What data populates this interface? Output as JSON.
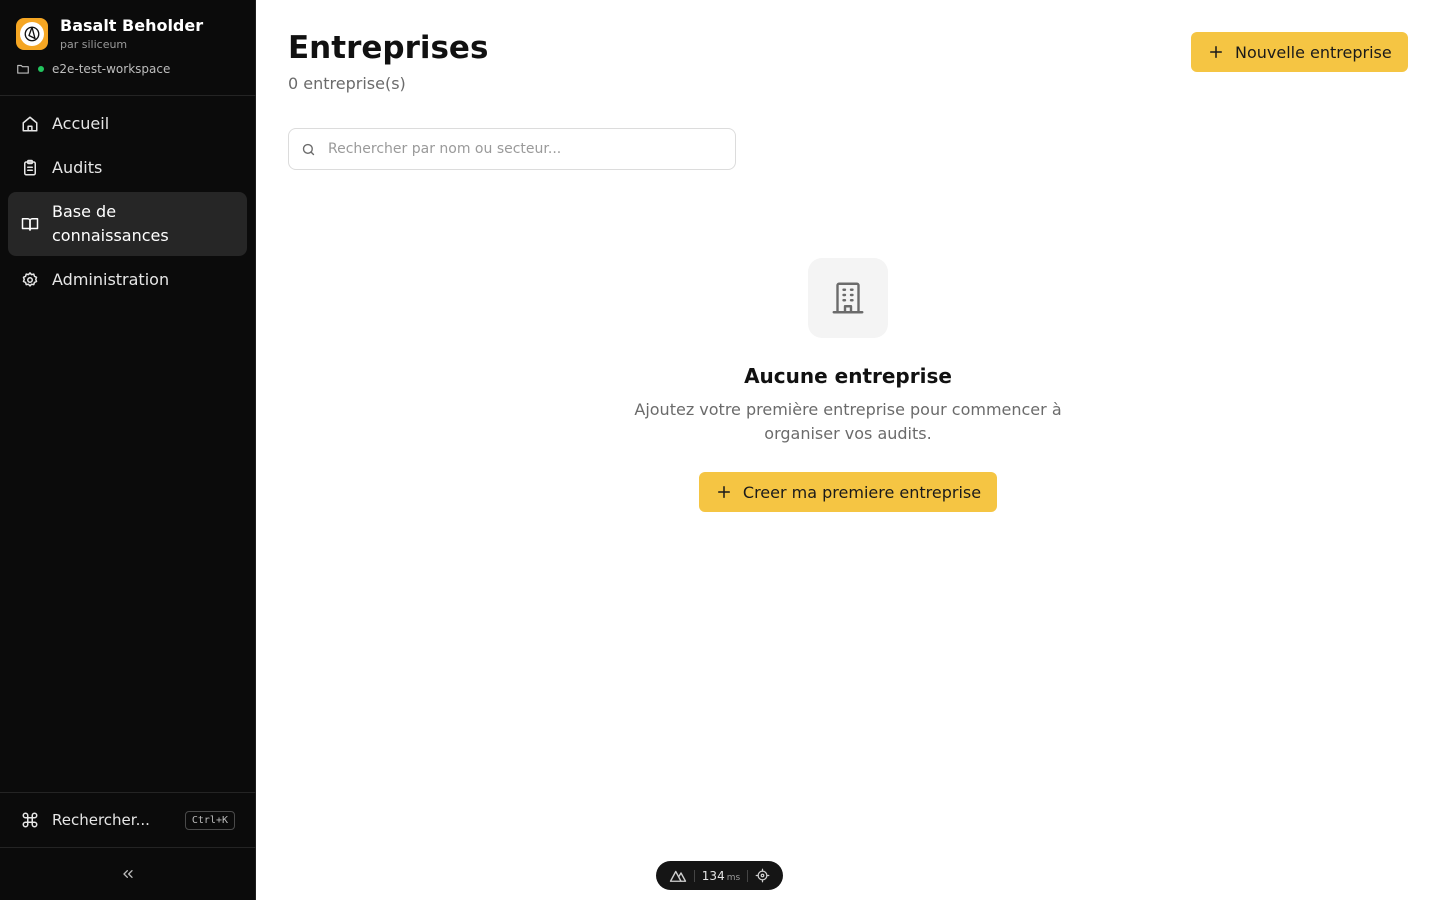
{
  "brand": {
    "title": "Basalt Beholder",
    "subtitle": "par siliceum",
    "logo_icon": "aperture-logo-icon",
    "accent_color": "#f5a623"
  },
  "workspace": {
    "name": "e2e-test-workspace",
    "status_color": "#22c55e"
  },
  "sidebar": {
    "items": [
      {
        "label": "Accueil",
        "icon": "home-icon",
        "active": false
      },
      {
        "label": "Audits",
        "icon": "clipboard-icon",
        "active": false
      },
      {
        "label": "Base de connaissances",
        "icon": "book-open-icon",
        "active": true
      },
      {
        "label": "Administration",
        "icon": "gear-icon",
        "active": false
      }
    ],
    "search_label": "Rechercher...",
    "search_shortcut": "Ctrl+K",
    "collapse_icon": "chevrons-left-icon"
  },
  "main": {
    "title": "Entreprises",
    "count": "0 entreprise(s)",
    "new_button": "Nouvelle entreprise",
    "search_placeholder": "Rechercher par nom ou secteur...",
    "empty": {
      "icon": "building-icon",
      "title": "Aucune entreprise",
      "description": "Ajoutez votre première entreprise pour commencer à organiser vos audits.",
      "cta": "Creer ma premiere entreprise"
    }
  },
  "devtools": {
    "timing_value": "134",
    "timing_unit": "ms"
  },
  "colors": {
    "sidebar_bg": "#0b0b0b",
    "active_item_bg": "#262626",
    "primary_button": "#f5c543"
  }
}
